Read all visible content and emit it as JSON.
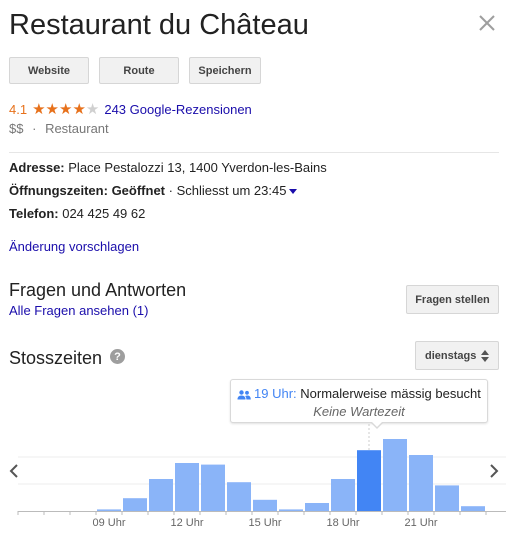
{
  "header": {
    "title": "Restaurant du Château"
  },
  "actions": {
    "website": "Website",
    "route": "Route",
    "save": "Speichern"
  },
  "rating": {
    "value": "4.1",
    "stars": 4.1,
    "reviews_link": "243 Google-Rezensionen"
  },
  "meta": {
    "price": "$$",
    "separator": "·",
    "category": "Restaurant"
  },
  "details": {
    "address_label": "Adresse:",
    "address_value": "Place Pestalozzi 13, 1400 Yverdon-les-Bains",
    "hours_label": "Öffnungszeiten:",
    "hours_status": "Geöffnet",
    "hours_separator": "·",
    "hours_detail": "Schliesst um 23:45",
    "phone_label": "Telefon:",
    "phone_value": "024 425 49 62"
  },
  "suggest_edit": "Änderung vorschlagen",
  "qa": {
    "title": "Fragen und Antworten",
    "all_link": "Alle Fragen ansehen (1)",
    "ask_button": "Fragen stellen"
  },
  "popular_times": {
    "title": "Stosszeiten",
    "help_icon": "help-icon",
    "day": "dienstags",
    "tooltip_time": "19 Uhr:",
    "tooltip_text": "Normalerweise mässig besucht",
    "tooltip_wait": "Keine Wartezeit",
    "colors": {
      "bar": "#8ab4f8",
      "bar_current": "#4285f4",
      "gridline": "#eeeeee",
      "axis": "#bbbbbb"
    }
  },
  "chart_data": {
    "type": "bar",
    "categories": [
      "06",
      "07",
      "08",
      "09",
      "10",
      "11",
      "12",
      "13",
      "14",
      "15",
      "16",
      "17",
      "18",
      "19",
      "20",
      "21",
      "22",
      "23",
      "00"
    ],
    "values": [
      0,
      0,
      0,
      1,
      8,
      20,
      30,
      29,
      18,
      7,
      1,
      5,
      20,
      38,
      45,
      35,
      16,
      3,
      0
    ],
    "current_index": 13,
    "tick_labels": [
      {
        "index": 3,
        "label": "09 Uhr"
      },
      {
        "index": 6,
        "label": "12 Uhr"
      },
      {
        "index": 9,
        "label": "15 Uhr"
      },
      {
        "index": 12,
        "label": "18 Uhr"
      },
      {
        "index": 15,
        "label": "21 Uhr"
      }
    ],
    "ylim": [
      0,
      50
    ],
    "grid": true
  }
}
